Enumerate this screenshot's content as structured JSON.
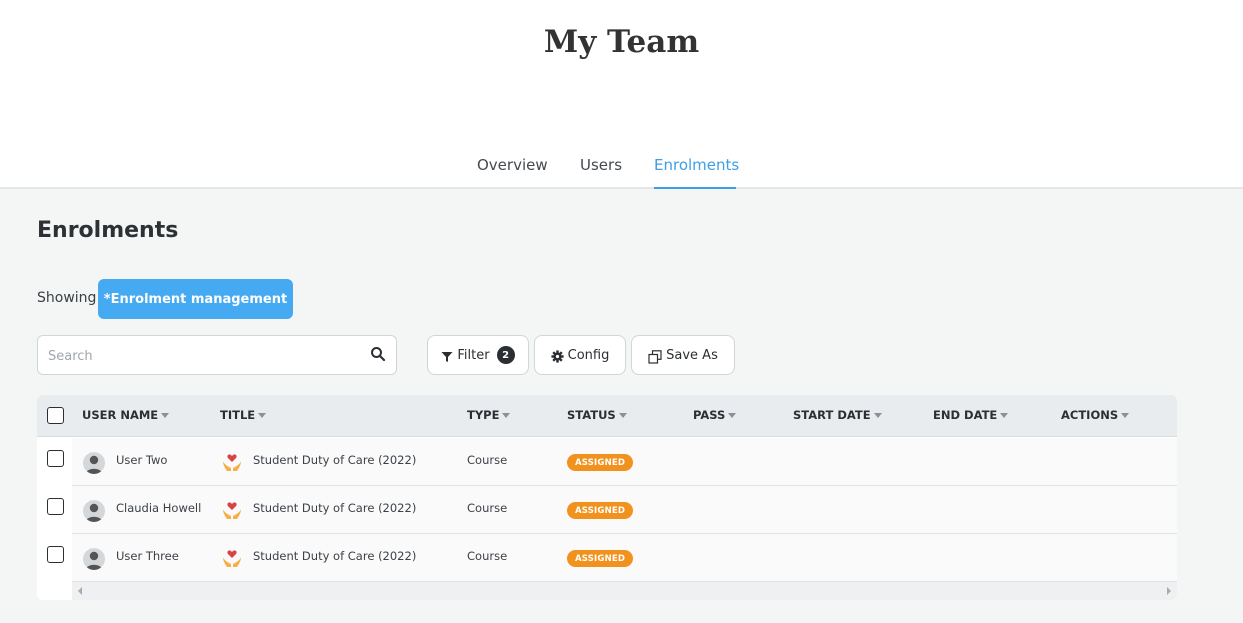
{
  "page": {
    "title": "My Team"
  },
  "tabs": [
    {
      "label": "Overview"
    },
    {
      "label": "Users"
    },
    {
      "label": "Enrolments",
      "active": true
    }
  ],
  "section": {
    "title": "Enrolments"
  },
  "showing": {
    "label": "Showing:",
    "view_name": "*Enrolment management"
  },
  "search": {
    "placeholder": "Search",
    "value": ""
  },
  "toolbar": {
    "filter_label": "Filter",
    "filter_count": "2",
    "config_label": "Config",
    "save_as_label": "Save As"
  },
  "table": {
    "columns": [
      "USER NAME",
      "TITLE",
      "TYPE",
      "STATUS",
      "PASS",
      "START DATE",
      "END DATE",
      "ACTIONS"
    ],
    "rows": [
      {
        "user": "User Two",
        "title": "Student Duty of Care (2022)",
        "type": "Course",
        "status": "ASSIGNED",
        "pass": "",
        "start_date": "",
        "end_date": ""
      },
      {
        "user": "Claudia Howell",
        "title": "Student Duty of Care (2022)",
        "type": "Course",
        "status": "ASSIGNED",
        "pass": "",
        "start_date": "",
        "end_date": ""
      },
      {
        "user": "User Three",
        "title": "Student Duty of Care (2022)",
        "type": "Course",
        "status": "ASSIGNED",
        "pass": "",
        "start_date": "",
        "end_date": ""
      }
    ]
  },
  "colors": {
    "accent": "#45aaf2",
    "active_tab": "#3f9ee6",
    "status_assigned": "#f2921e",
    "header_bg": "#e9ecee",
    "page_bg": "#f4f6f5"
  },
  "icons": {
    "search": "search-icon",
    "filter": "funnel-icon",
    "config": "gear-icon",
    "save_as": "copy-icon",
    "avatar": "user-avatar-icon",
    "course": "heart-hands-icon",
    "sort": "caret-down-icon"
  }
}
